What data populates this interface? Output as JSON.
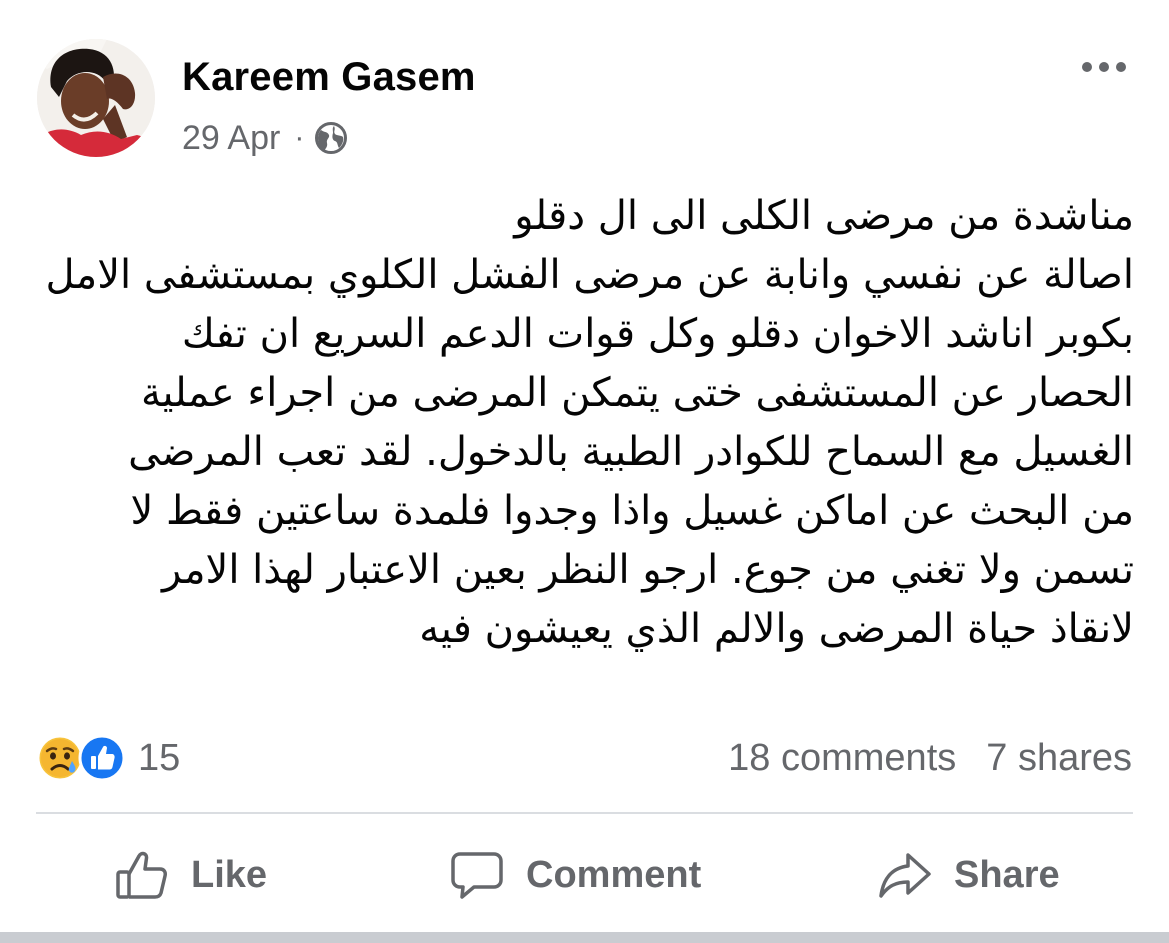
{
  "post": {
    "author": "Kareem Gasem",
    "date": "29 Apr",
    "separator": "·",
    "audience_icon": "globe-icon",
    "more_icon": "more-dots-icon",
    "text_lines": [
      "مناشدة من مرضى الكلى الى ال دقلو",
      "اصالة عن نفسي وانابة عن مرضى الفشل الكلوي بمستشفى الامل",
      "بكوبر اناشد الاخوان دقلو وكل قوات الدعم السريع ان تفك",
      "الحصار عن المستشفى ختى يتمكن المرضى من اجراء عملية",
      "الغسيل مع السماح للكوادر الطبية بالدخول. لقد تعب المرضى",
      "من البحث عن اماكن غسيل واذا وجدوا فلمدة ساعتين فقط لا",
      "تسمن ولا تغني من جوع. ارجو النظر بعين الاعتبار لهذا الامر",
      "لانقاذ حياة المرضى والالم الذي يعيشون فيه"
    ]
  },
  "reactions": {
    "icons": [
      "sad-tear-reaction-icon",
      "like-reaction-icon"
    ],
    "count": "15"
  },
  "stats": {
    "comments": "18 comments",
    "shares": "7 shares"
  },
  "actions": {
    "like": "Like",
    "comment": "Comment",
    "share": "Share"
  },
  "colors": {
    "text_primary": "#050505",
    "text_secondary": "#65676b",
    "like_blue": "#1877f2",
    "sad_yellow": "#f7b125",
    "divider": "#dadde1"
  }
}
